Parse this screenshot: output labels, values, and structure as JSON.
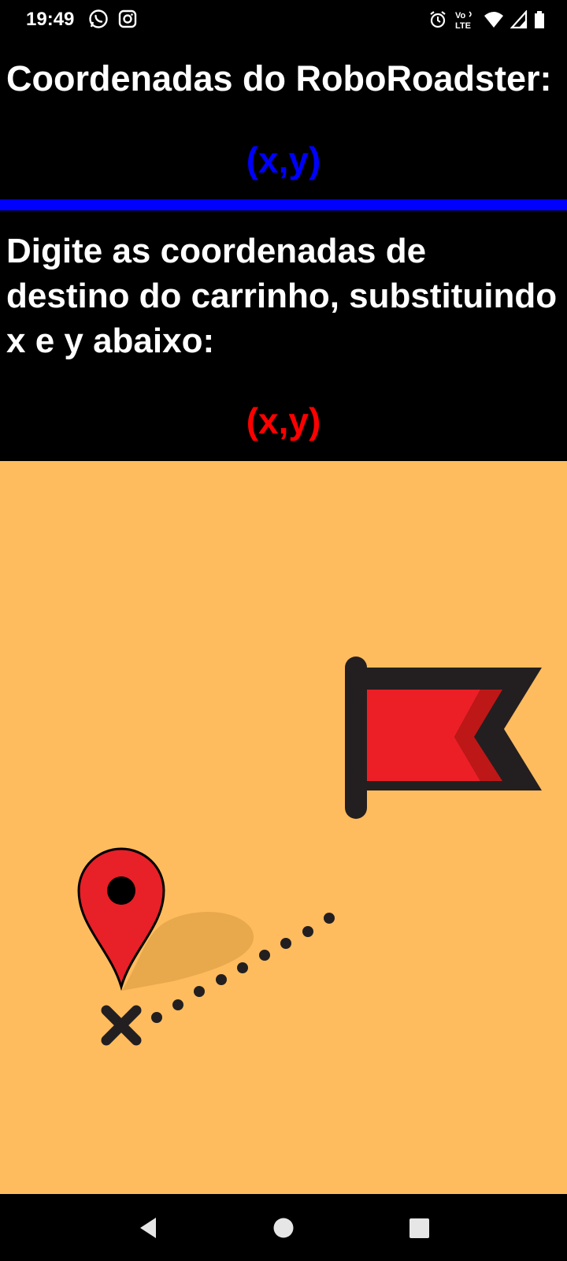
{
  "status_bar": {
    "time": "19:49",
    "left_icons": [
      "whatsapp-icon",
      "instagram-icon"
    ],
    "right_icons": [
      "alarm-icon",
      "volte-icon",
      "wifi-icon",
      "signal-icon",
      "battery-icon"
    ],
    "volte_label": "Vo LTE"
  },
  "header": {
    "title": "Coordenadas do RoboRoadster:",
    "current_coordinates": "(x,y)",
    "current_coordinates_color": "#0000ff"
  },
  "divider_color": "#0000ff",
  "input_section": {
    "instruction": "Digite as coordenadas de destino do carrinho, substituindo x e y abaixo:",
    "destination_coordinates": "(x,y)",
    "destination_coordinates_color": "#ff0000"
  },
  "illustration": {
    "background_color": "#ffbc5e",
    "elements": [
      "map-pin-icon",
      "x-mark-icon",
      "dotted-path",
      "flag-icon"
    ],
    "pin_color": "#e82027",
    "flag_color": "#ec1f26"
  },
  "nav_bar": {
    "buttons": [
      "back-icon",
      "home-icon",
      "recents-icon"
    ]
  }
}
